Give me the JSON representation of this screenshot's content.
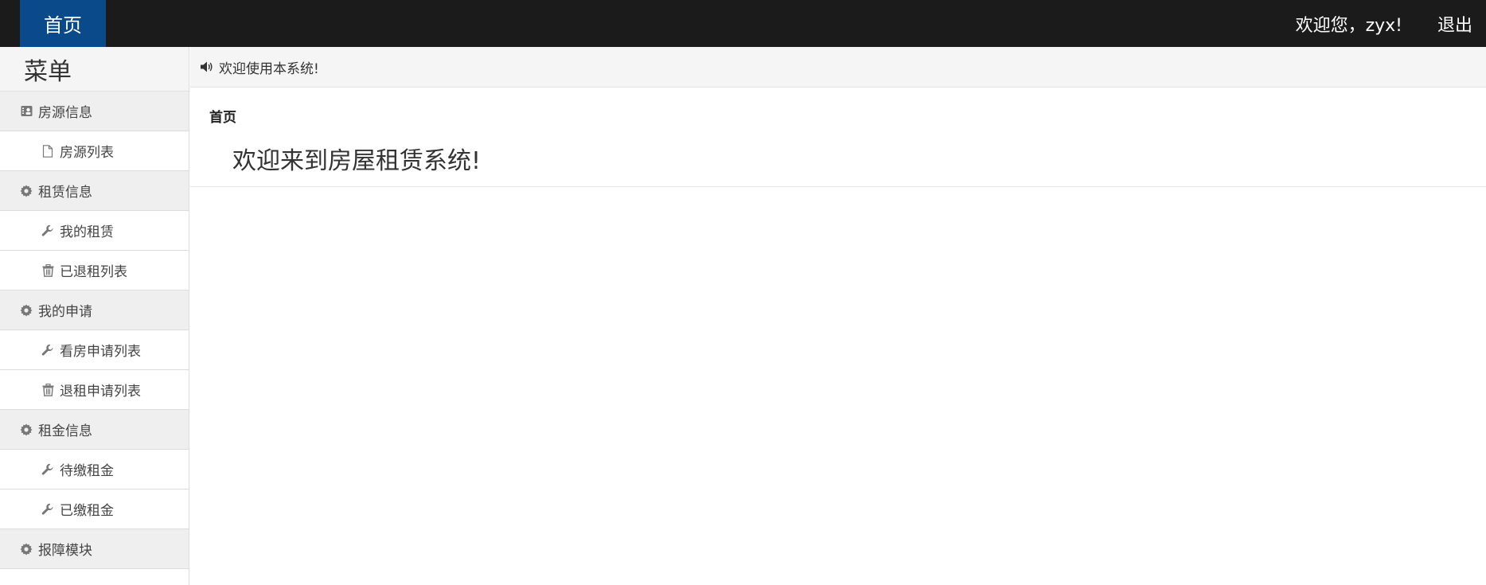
{
  "topbar": {
    "home_label": "首页",
    "greeting": "欢迎您，zyx!",
    "logout_label": "退出"
  },
  "sidebar": {
    "title": "菜单",
    "items": [
      {
        "type": "group",
        "icon": "contact-card-icon",
        "label": "房源信息"
      },
      {
        "type": "item",
        "icon": "file-icon",
        "label": "房源列表"
      },
      {
        "type": "group",
        "icon": "gear-icon",
        "label": "租赁信息"
      },
      {
        "type": "item",
        "icon": "wrench-icon",
        "label": "我的租赁"
      },
      {
        "type": "item",
        "icon": "trash-icon",
        "label": "已退租列表"
      },
      {
        "type": "group",
        "icon": "gear-icon",
        "label": "我的申请"
      },
      {
        "type": "item",
        "icon": "wrench-icon",
        "label": "看房申请列表"
      },
      {
        "type": "item",
        "icon": "trash-icon",
        "label": "退租申请列表"
      },
      {
        "type": "group",
        "icon": "gear-icon",
        "label": "租金信息"
      },
      {
        "type": "item",
        "icon": "wrench-icon",
        "label": "待缴租金"
      },
      {
        "type": "item",
        "icon": "wrench-icon",
        "label": "已缴租金"
      },
      {
        "type": "group",
        "icon": "gear-icon",
        "label": "报障模块"
      }
    ]
  },
  "main": {
    "notice_icon": "speaker-icon",
    "notice": "欢迎使用本系统!",
    "breadcrumb": "首页",
    "welcome": "欢迎来到房屋租赁系统!"
  }
}
